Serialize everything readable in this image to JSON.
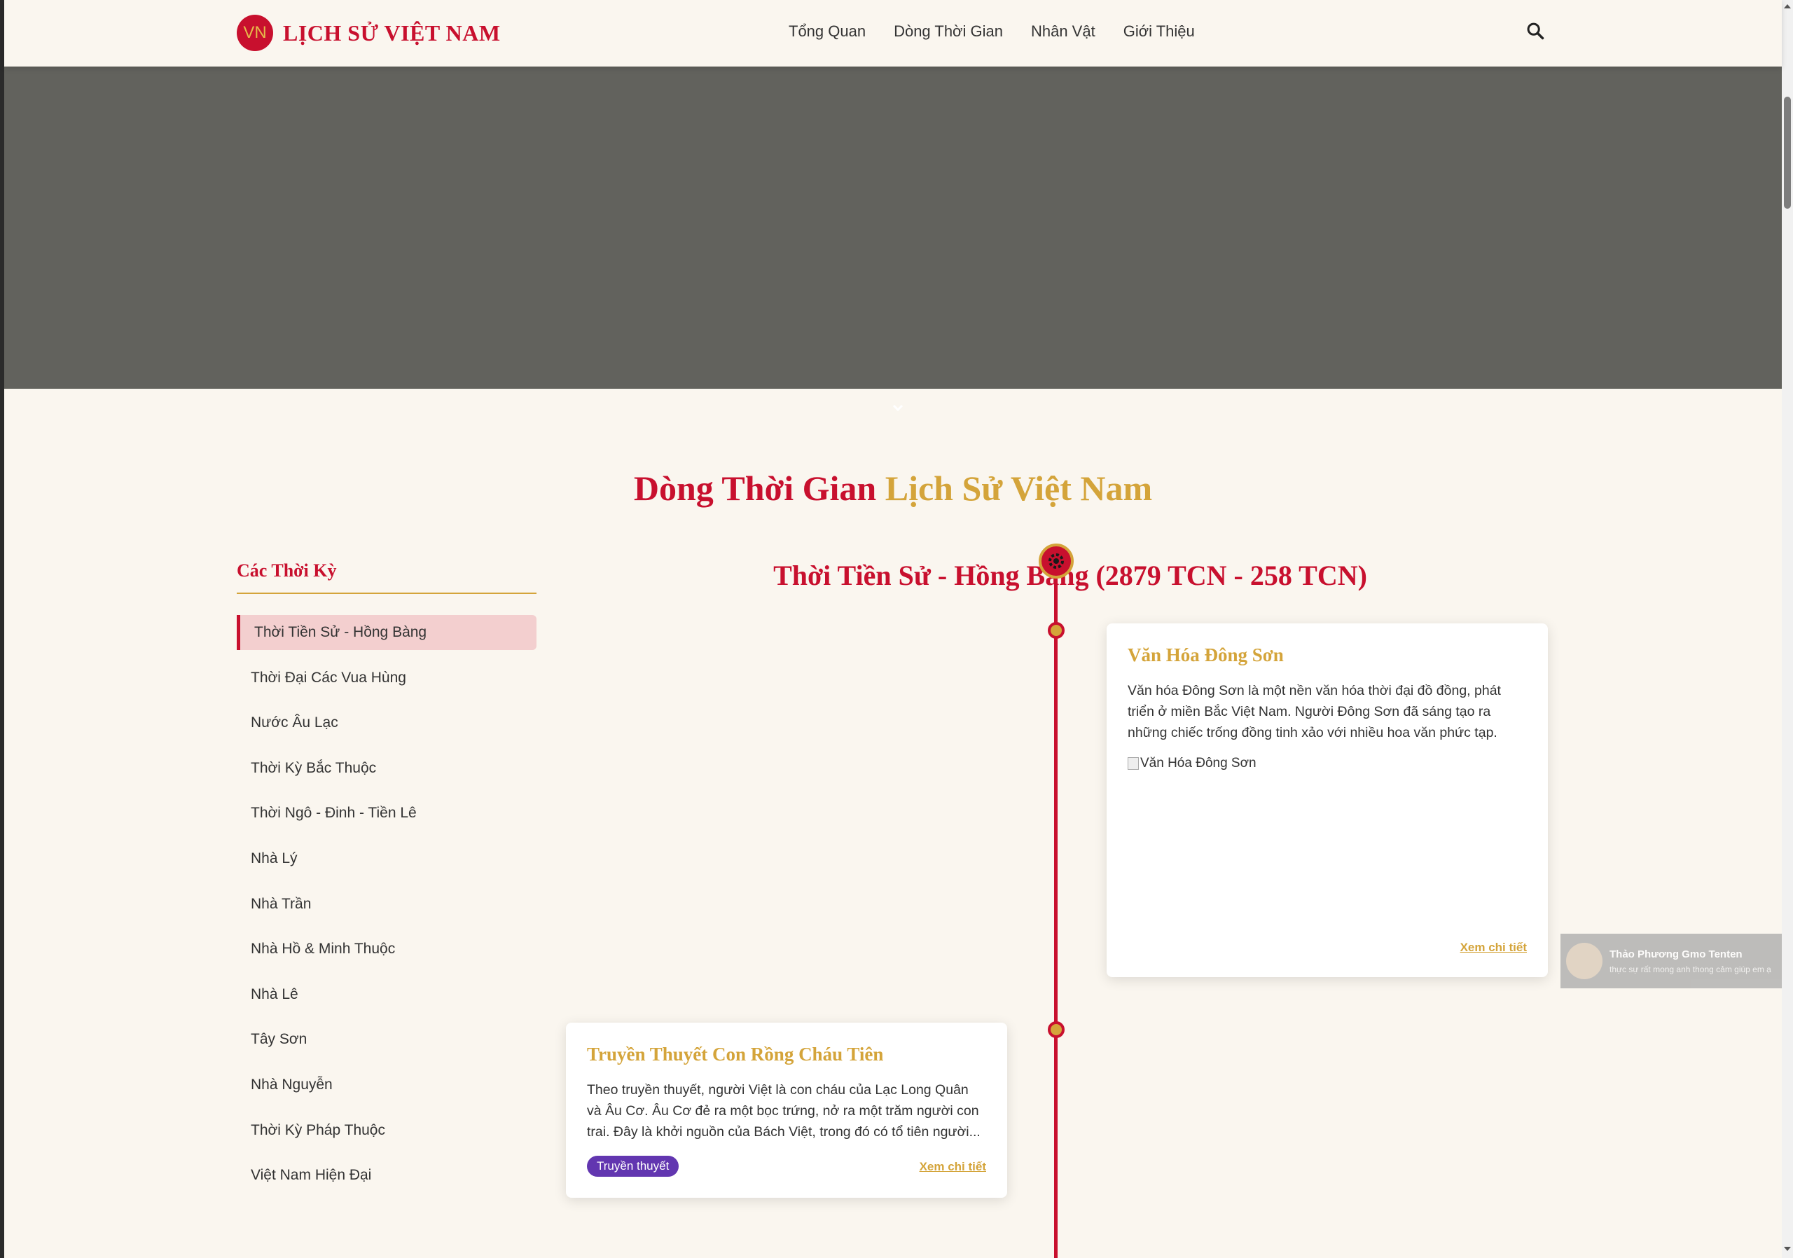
{
  "header": {
    "logo_badge": "VN",
    "logo_text": "LỊCH SỬ VIỆT NAM",
    "nav": [
      "Tổng Quan",
      "Dòng Thời Gian",
      "Nhân Vật",
      "Giới Thiệu"
    ],
    "search_icon": "search-icon"
  },
  "hero": {
    "scroll_icon": "chevron-down-icon"
  },
  "section": {
    "title_part1": "Dòng Thời Gian",
    "title_part2": "Lịch Sử Việt Nam"
  },
  "sidebar": {
    "title": "Các Thời Kỳ",
    "items": [
      "Thời Tiền Sử - Hồng Bàng",
      "Thời Đại Các Vua Hùng",
      "Nước Âu Lạc",
      "Thời Kỳ Bắc Thuộc",
      "Thời Ngô - Đinh - Tiền Lê",
      "Nhà Lý",
      "Nhà Trần",
      "Nhà Hồ & Minh Thuộc",
      "Nhà Lê",
      "Tây Sơn",
      "Nhà Nguyễn",
      "Thời Kỳ Pháp Thuộc",
      "Việt Nam Hiện Đại"
    ],
    "active_index": 0
  },
  "timeline": {
    "period_title": "Thời Tiền Sử - Hồng Bàng (2879 TCN - 258 TCN)",
    "events": [
      {
        "title": "Văn Hóa Đông Sơn",
        "description": "Văn hóa Đông Sơn là một nền văn hóa thời đại đồ đồng, phát triển ở miền Bắc Việt Nam. Người Đông Sơn đã sáng tạo ra những chiếc trống đồng tinh xảo với nhiều hoa văn phức tạp.",
        "image_alt": "Văn Hóa Đông Sơn",
        "link": "Xem chi tiết"
      },
      {
        "title": "Truyền Thuyết Con Rồng Cháu Tiên",
        "description": "Theo truyền thuyết, người Việt là con cháu của Lạc Long Quân và Âu Cơ. Âu Cơ đẻ ra một bọc trứng, nở ra một trăm người con trai. Đây là khởi nguồn của Bách Việt, trong đó có tổ tiên người...",
        "tag": "Truyền thuyết",
        "link": "Xem chi tiết"
      }
    ]
  },
  "toast": {
    "name": "Thảo Phương Gmo Tenten",
    "message": "thực sự rất mong anh thong cảm giúp em ạ",
    "close": "×"
  },
  "colors": {
    "primary_red": "#c8102e",
    "gold": "#d4a43a",
    "background": "#faf6ef",
    "hero_gray": "#62625d",
    "tag_purple": "#6236b0"
  }
}
